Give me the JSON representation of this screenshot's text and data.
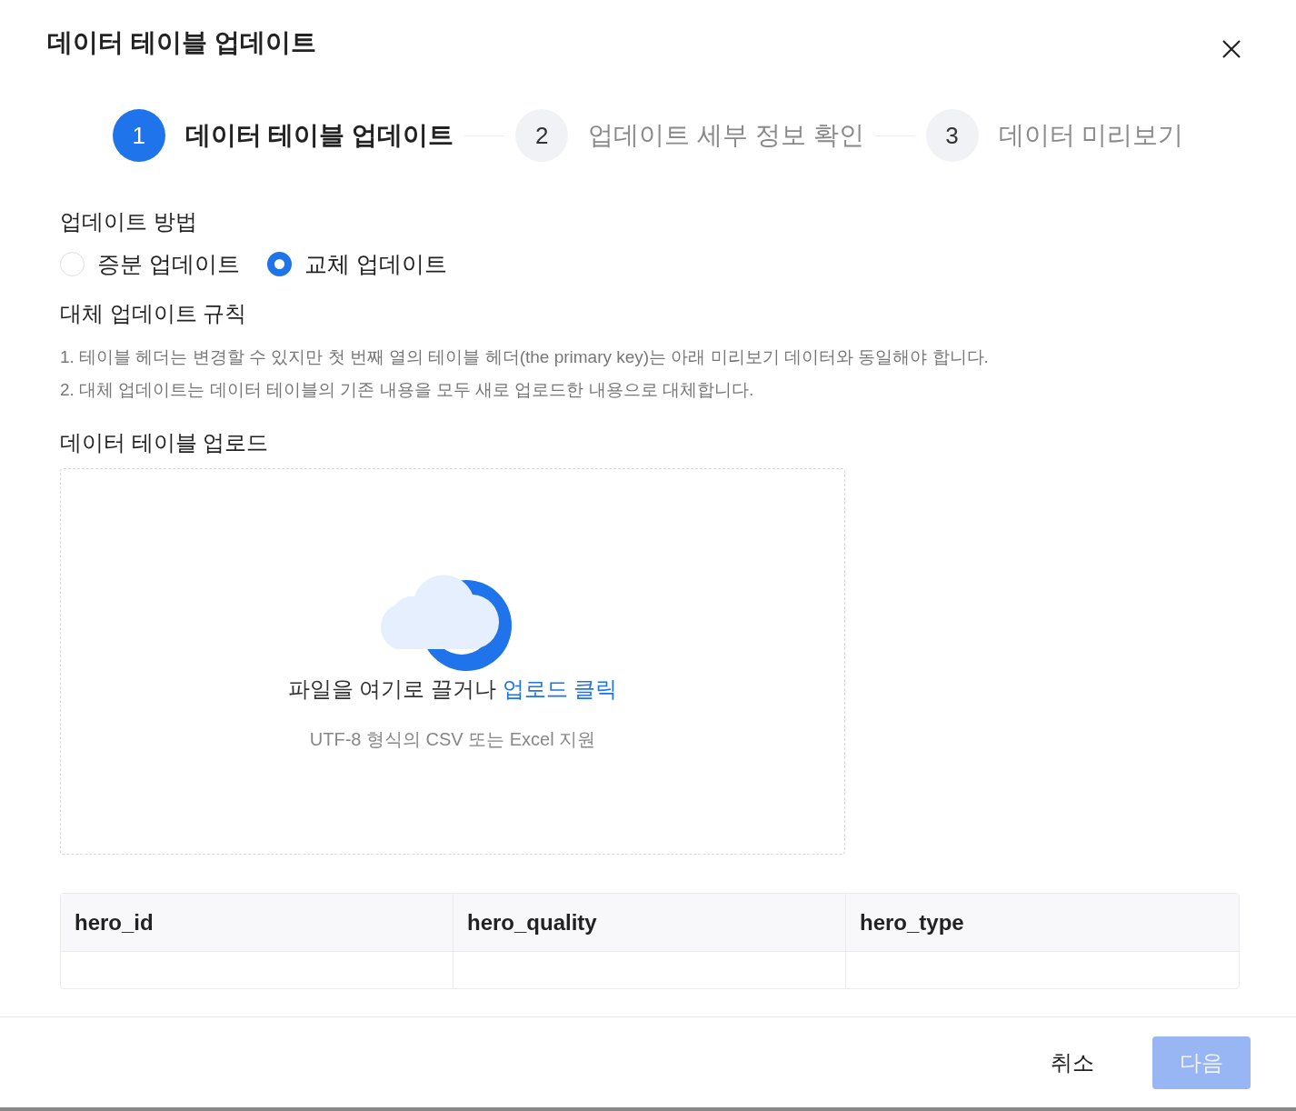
{
  "dialog": {
    "title": "데이터 테이블 업데이트"
  },
  "steps": [
    {
      "number": "1",
      "label": "데이터 테이블 업데이트",
      "selected": true
    },
    {
      "number": "2",
      "label": "업데이트 세부 정보 확인",
      "selected": false
    },
    {
      "number": "3",
      "label": "데이터 미리보기",
      "selected": false
    }
  ],
  "update_method": {
    "label": "업데이트 방법",
    "options": [
      {
        "label": "증분 업데이트",
        "selected": false
      },
      {
        "label": "교체 업데이트",
        "selected": true
      }
    ]
  },
  "rules": {
    "title": "대체 업데이트 규칙",
    "items": [
      "1. 테이블 헤더는 변경할 수 있지만 첫 번째 열의 테이블 헤더(the primary key)는 아래 미리보기 데이터와 동일해야 합니다.",
      "2. 대체 업데이트는 데이터 테이블의 기존 내용을 모두 새로 업로드한 내용으로 대체합니다."
    ]
  },
  "upload": {
    "label": "데이터 테이블 업로드",
    "prompt": "파일을 여기로 끌거나",
    "link": "업로드 클릭",
    "hint": "UTF-8 형식의 CSV 또는 Excel 지원"
  },
  "table": {
    "columns": [
      "hero_id",
      "hero_quality",
      "hero_type"
    ]
  },
  "footer": {
    "buttons": [
      {
        "label": "취소",
        "kind": "secondary",
        "disabled": false
      },
      {
        "label": "다음",
        "kind": "primary",
        "disabled": true
      }
    ]
  }
}
